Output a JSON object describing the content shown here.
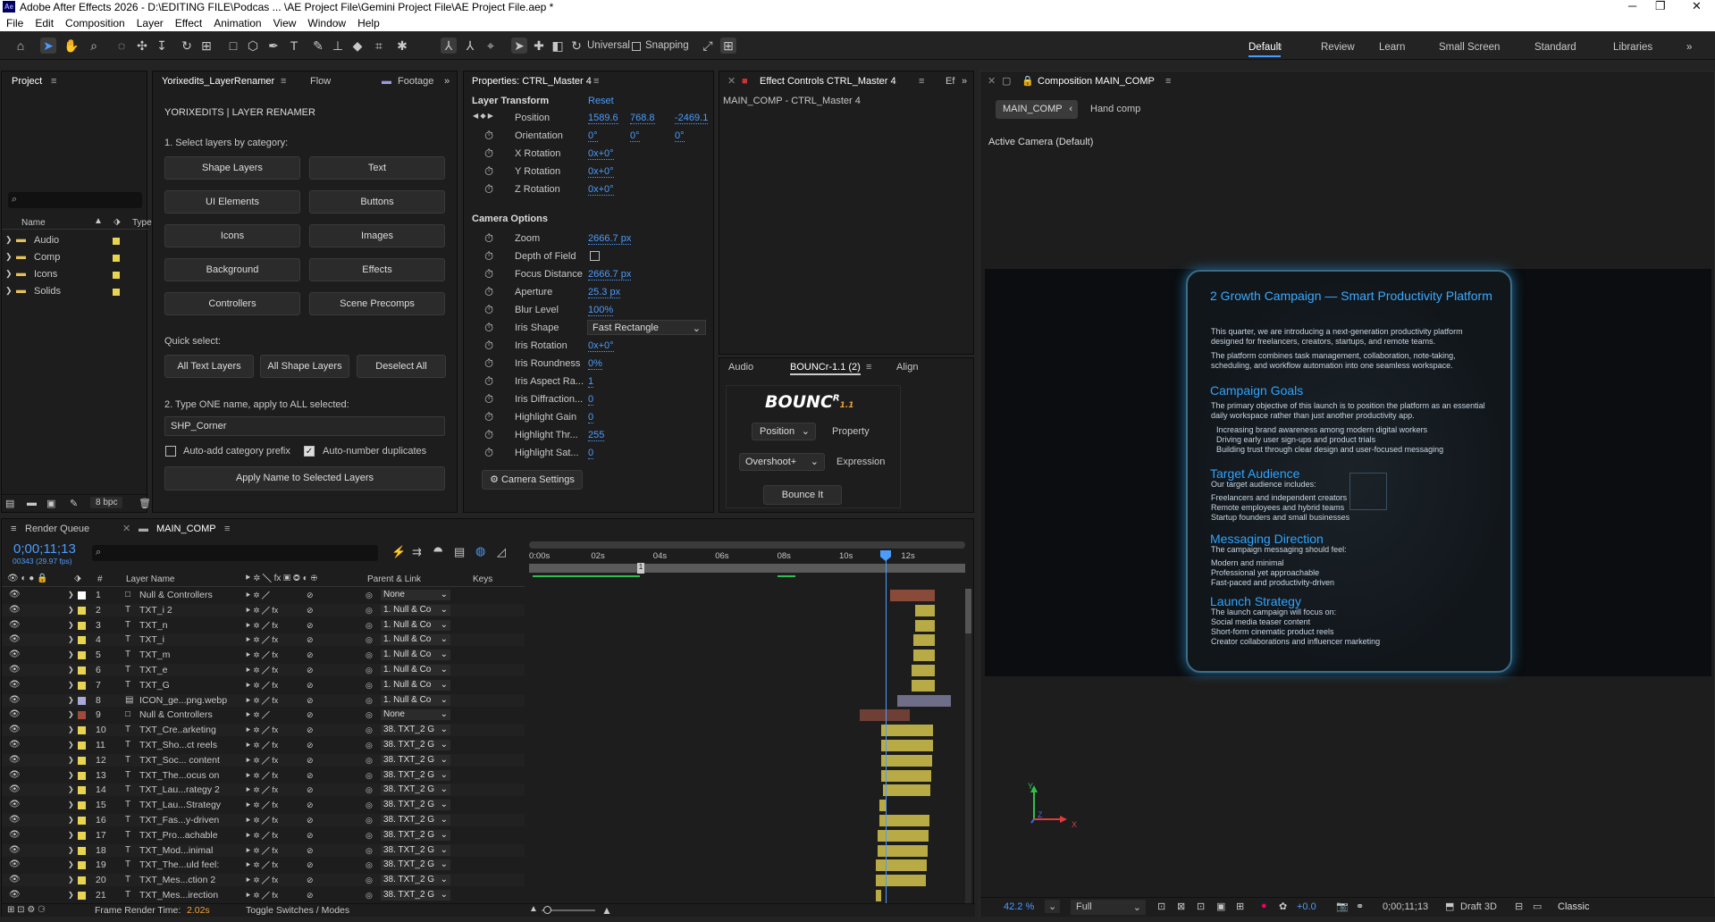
{
  "window": {
    "title": "Adobe After Effects 2026 - D:\\EDITING FILE\\Podcas ... \\AE Project File\\Gemini Project File\\AE Project File.aep *",
    "logo": "Ae"
  },
  "menu": [
    "File",
    "Edit",
    "Composition",
    "Layer",
    "Effect",
    "Animation",
    "View",
    "Window",
    "Help"
  ],
  "toolbar": {
    "universal": "Universal",
    "snapping": "Snapping"
  },
  "workspaces": [
    "Default",
    "Review",
    "Learn",
    "Small Screen",
    "Standard",
    "Libraries"
  ],
  "project": {
    "tab": "Project",
    "search_placeholder": "",
    "col_name": "Name",
    "col_type": "Type",
    "items": [
      "Audio",
      "Comp",
      "Icons",
      "Solids"
    ],
    "bpc": "8 bpc"
  },
  "renamer": {
    "tab1": "Yorixedits_LayerRenamer",
    "tab2": "Flow",
    "tab3": "Footage",
    "header": "YORIXEDITS | LAYER RENAMER",
    "step1": "1. Select layers by category:",
    "categories": [
      "Shape Layers",
      "Text",
      "UI Elements",
      "Buttons",
      "Icons",
      "Images",
      "Background",
      "Effects",
      "Controllers",
      "Scene Precomps"
    ],
    "quick_select": "Quick select:",
    "quick": [
      "All Text Layers",
      "All Shape Layers",
      "Deselect All"
    ],
    "step2": "2. Type ONE name, apply to ALL selected:",
    "name_value": "SHP_Corner",
    "auto_prefix": "Auto-add category prefix",
    "auto_number": "Auto-number duplicates",
    "apply": "Apply Name to Selected Layers"
  },
  "properties": {
    "tab": "Properties: CTRL_Master 4",
    "transform": "Layer Transform",
    "reset": "Reset",
    "position": {
      "label": "Position",
      "x": "1589.6",
      "y": "768.8",
      "z": "-2469.1"
    },
    "orientation": {
      "label": "Orientation",
      "x": "0°",
      "y": "0°",
      "z": "0°"
    },
    "rotations": [
      {
        "label": "X Rotation",
        "v": "0x+0°"
      },
      {
        "label": "Y Rotation",
        "v": "0x+0°"
      },
      {
        "label": "Z Rotation",
        "v": "0x+0°"
      }
    ],
    "camera_options": "Camera Options",
    "camera": [
      {
        "label": "Zoom",
        "v": "2666.7 px"
      },
      {
        "label": "Depth of Field",
        "v": ""
      },
      {
        "label": "Focus Distance",
        "v": "2666.7 px"
      },
      {
        "label": "Aperture",
        "v": "25.3 px"
      },
      {
        "label": "Blur Level",
        "v": "100%"
      },
      {
        "label": "Iris Shape",
        "v": "Fast Rectangle"
      },
      {
        "label": "Iris Rotation",
        "v": "0x+0°"
      },
      {
        "label": "Iris Roundness",
        "v": "0%"
      },
      {
        "label": "Iris Aspect Ra...",
        "v": "1"
      },
      {
        "label": "Iris Diffraction...",
        "v": "0"
      },
      {
        "label": "Highlight Gain",
        "v": "0"
      },
      {
        "label": "Highlight Thr...",
        "v": "255"
      },
      {
        "label": "Highlight Sat...",
        "v": "0"
      }
    ],
    "camera_settings": "Camera Settings"
  },
  "effect_controls": {
    "tab": "Effect Controls CTRL_Master 4",
    "tab2": "Ef",
    "path": "MAIN_COMP - CTRL_Master 4"
  },
  "bouncr": {
    "tab1": "Audio",
    "tab2": "BOUNCr-1.1 (2)",
    "tab3": "Align",
    "logo": "BOUNC",
    "logo_sup": "R",
    "logo_ver": "1.1",
    "prop": "Position",
    "prop_label": "Property",
    "expr": "Overshoot+",
    "expr_label": "Expression",
    "button": "Bounce It"
  },
  "composition": {
    "tab": "Composition MAIN_COMP",
    "crumb": "MAIN_COMP",
    "crumb2": "Hand comp",
    "camera": "Active Camera (Default)",
    "zoom": "42.2 %",
    "quality": "Full",
    "exposure": "+0.0",
    "timecode": "0;00;11;13",
    "renderer": "Draft 3D",
    "mode": "Classic",
    "axes": {
      "y": "Y",
      "z": "Z",
      "x": "X"
    }
  },
  "poster": {
    "title": "2 Growth Campaign — Smart Productivity Platform",
    "p1": [
      "This quarter, we are introducing a next-generation productivity platform",
      "designed for freelancers, creators, startups, and remote teams."
    ],
    "p2": [
      "The platform combines task management, collaboration, note-taking,",
      "scheduling, and workflow automation into one seamless workspace."
    ],
    "h1": "Campaign Goals",
    "g1": [
      "The primary objective of this launch is to position the platform as an essential",
      "daily workspace rather than just another productivity app."
    ],
    "g2": [
      "Increasing brand awareness among modern digital workers",
      "Driving early user sign-ups and product trials",
      "Building trust through clear design and user-focused messaging"
    ],
    "h2": "Target Audience",
    "t1": [
      "Our target audience includes:",
      "Freelancers and independent creators",
      "Remote employees and hybrid teams",
      "Startup founders and small businesses"
    ],
    "h3": "Messaging Direction",
    "m1": [
      "The campaign messaging should feel:",
      "Modern and minimal",
      "Professional yet approachable",
      "Fast-paced and productivity-driven"
    ],
    "h4": "Launch Strategy",
    "l1": [
      "The launch campaign will focus on:",
      "Social media teaser content",
      "Short-form cinematic product reels",
      "Creator collaborations and influencer marketing"
    ]
  },
  "timeline": {
    "tab_rq": "Render Queue",
    "tab_comp": "MAIN_COMP",
    "timecode": "0;00;11;13",
    "frames": "00343 (29.97 fps)",
    "col_layer": "Layer Name",
    "col_parent": "Parent & Link",
    "col_keys": "Keys",
    "ruler": [
      "0:00s",
      "02s",
      "04s",
      "06s",
      "08s",
      "10s",
      "12s"
    ],
    "frame_render": "Frame Render Time:",
    "frame_render_val": "2.02s",
    "toggle": "Toggle Switches / Modes",
    "layers": [
      {
        "n": "1",
        "name": "Null & Controllers",
        "parent": "None",
        "color": "#ffffff",
        "type": "null"
      },
      {
        "n": "2",
        "name": "TXT_i 2",
        "parent": "1. Null & Co",
        "color": "#e8d450",
        "type": "T"
      },
      {
        "n": "3",
        "name": "TXT_n",
        "parent": "1. Null & Co",
        "color": "#e8d450",
        "type": "T"
      },
      {
        "n": "4",
        "name": "TXT_i",
        "parent": "1. Null & Co",
        "color": "#e8d450",
        "type": "T"
      },
      {
        "n": "5",
        "name": "TXT_m",
        "parent": "1. Null & Co",
        "color": "#e8d450",
        "type": "T"
      },
      {
        "n": "6",
        "name": "TXT_e",
        "parent": "1. Null & Co",
        "color": "#e8d450",
        "type": "T"
      },
      {
        "n": "7",
        "name": "TXT_G",
        "parent": "1. Null & Co",
        "color": "#e8d450",
        "type": "T"
      },
      {
        "n": "8",
        "name": "ICON_ge...png.webp",
        "parent": "1. Null & Co",
        "color": "#a9a9d9",
        "type": "img"
      },
      {
        "n": "9",
        "name": "Null & Controllers",
        "parent": "None",
        "color": "#a24a3a",
        "type": "null"
      },
      {
        "n": "10",
        "name": "TXT_Cre..arketing",
        "parent": "38. TXT_2 G",
        "color": "#e8d450",
        "type": "T"
      },
      {
        "n": "11",
        "name": "TXT_Sho...ct reels",
        "parent": "38. TXT_2 G",
        "color": "#e8d450",
        "type": "T"
      },
      {
        "n": "12",
        "name": "TXT_Soc... content",
        "parent": "38. TXT_2 G",
        "color": "#e8d450",
        "type": "T"
      },
      {
        "n": "13",
        "name": "TXT_The...ocus on",
        "parent": "38. TXT_2 G",
        "color": "#e8d450",
        "type": "T"
      },
      {
        "n": "14",
        "name": "TXT_Lau...rategy 2",
        "parent": "38. TXT_2 G",
        "color": "#e8d450",
        "type": "T"
      },
      {
        "n": "15",
        "name": "TXT_Lau...Strategy",
        "parent": "38. TXT_2 G",
        "color": "#e8d450",
        "type": "T"
      },
      {
        "n": "16",
        "name": "TXT_Fas...y-driven",
        "parent": "38. TXT_2 G",
        "color": "#e8d450",
        "type": "T"
      },
      {
        "n": "17",
        "name": "TXT_Pro...achable",
        "parent": "38. TXT_2 G",
        "color": "#e8d450",
        "type": "T"
      },
      {
        "n": "18",
        "name": "TXT_Mod...inimal",
        "parent": "38. TXT_2 G",
        "color": "#e8d450",
        "type": "T"
      },
      {
        "n": "19",
        "name": "TXT_The...uld feel:",
        "parent": "38. TXT_2 G",
        "color": "#e8d450",
        "type": "T"
      },
      {
        "n": "20",
        "name": "TXT_Mes...ction 2",
        "parent": "38. TXT_2 G",
        "color": "#e8d450",
        "type": "T"
      },
      {
        "n": "21",
        "name": "TXT_Mes...irection",
        "parent": "38. TXT_2 G",
        "color": "#e8d450",
        "type": "T"
      }
    ]
  }
}
